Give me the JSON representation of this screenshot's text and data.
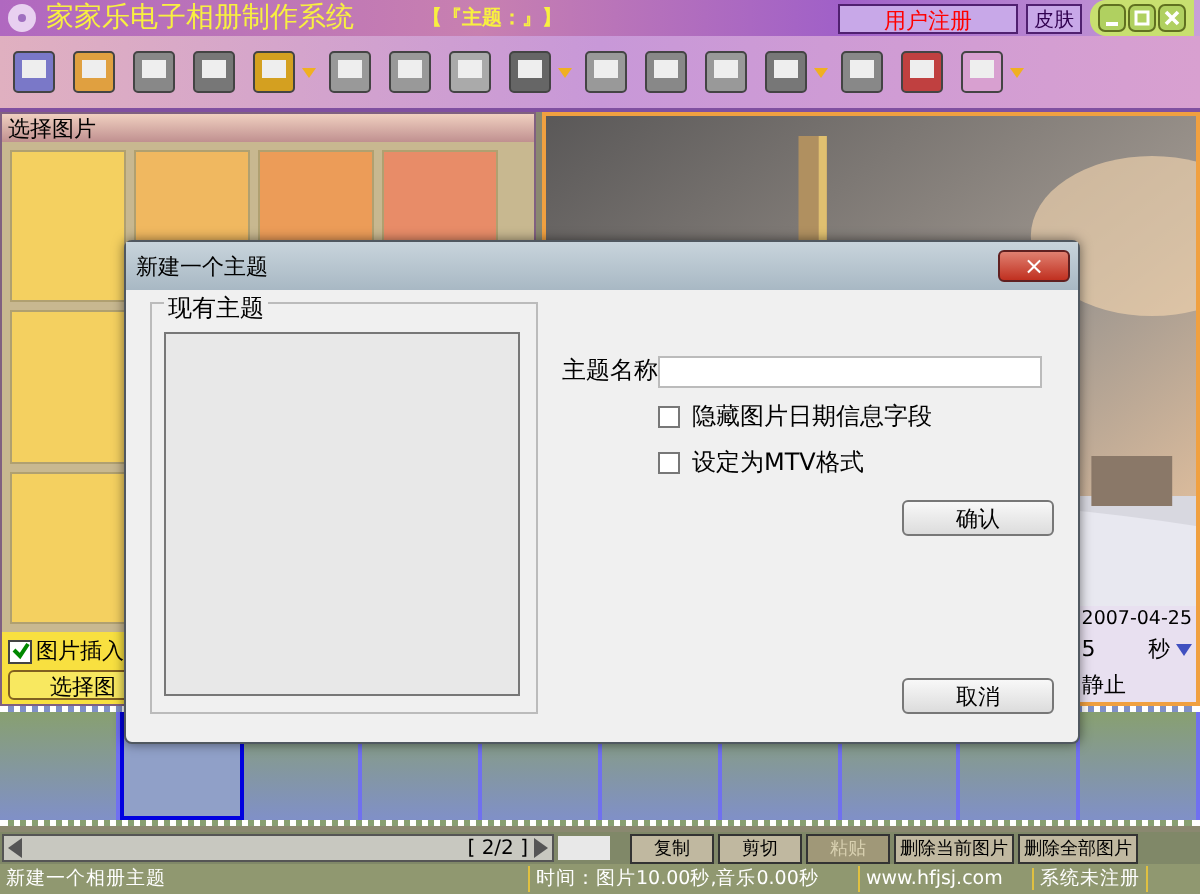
{
  "window": {
    "title": "家家乐电子相册制作系统",
    "theme_label": "【『主题：』】",
    "register_button": "用户注册",
    "skin_button": "皮肤"
  },
  "left_panel": {
    "title": "选择图片",
    "insert_checkbox": {
      "label": "图片插入",
      "checked": true
    },
    "select_button": "选择图"
  },
  "right_panel": {
    "date": "2007-04-25",
    "duration": "5",
    "unit": "秒",
    "effect": "静止"
  },
  "filmstrip": {
    "frames": [
      {
        "selected": false
      },
      {
        "selected": true
      },
      {
        "selected": false
      },
      {
        "selected": false
      },
      {
        "selected": false
      },
      {
        "selected": false
      },
      {
        "selected": false
      },
      {
        "selected": false
      },
      {
        "selected": false
      },
      {
        "selected": false
      }
    ]
  },
  "pager": "[ 2/2 ]",
  "actions": [
    {
      "label": "复制",
      "disabled": false
    },
    {
      "label": "剪切",
      "disabled": false
    },
    {
      "label": "粘贴",
      "disabled": true
    },
    {
      "label": "删除当前图片",
      "disabled": false
    },
    {
      "label": "删除全部图片",
      "disabled": false
    }
  ],
  "status_bar": [
    "新建一个相册主题",
    "时间：图片10.00秒,音乐0.00秒",
    "www.hfjsj.com",
    "系统未注册"
  ],
  "dialog": {
    "title": "新建一个主题",
    "close": "×",
    "group_title": "现有主题",
    "name_label": "主题名称",
    "options": [
      {
        "label": "隐藏图片日期信息字段",
        "checked": false
      },
      {
        "label": "设定为MTV格式",
        "checked": false
      }
    ],
    "ok_button": "确认",
    "cancel_button": "取消"
  }
}
